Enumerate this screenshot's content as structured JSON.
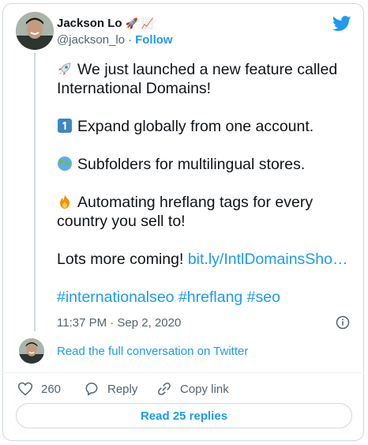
{
  "tweet": {
    "display_name": "Jackson Lo",
    "name_emojis": [
      "🚀",
      "📈"
    ],
    "handle": "@jackson_lo",
    "separator": "·",
    "follow_label": "Follow",
    "paragraphs": [
      {
        "emoji": "rocket",
        "lines": [
          "We just launched a new feature called",
          "International Domains!"
        ]
      },
      {
        "emoji": "keycap-1",
        "lines": [
          "Expand globally from one account."
        ]
      },
      {
        "emoji": "globe",
        "lines": [
          "Subfolders for multilingual stores."
        ]
      },
      {
        "emoji": "fire",
        "lines": [
          "Automating hreflang tags for every",
          "country you sell to!"
        ]
      }
    ],
    "lots_more_text": "Lots more coming!",
    "link_text": "bit.ly/IntlDomainsSho…",
    "hashtags": "#internationalseo #hreflang #seo",
    "timestamp": "11:37 PM · Sep 2, 2020"
  },
  "conversation": {
    "read_full_label": "Read the full conversation on Twitter"
  },
  "actions": {
    "like_count": "260",
    "reply_label": "Reply",
    "copy_link_label": "Copy link"
  },
  "read_replies_label": "Read 25 replies",
  "colors": {
    "accent": "#1d9bf0",
    "text": "#0f1419",
    "muted": "#536471",
    "border": "#cfd9de"
  }
}
